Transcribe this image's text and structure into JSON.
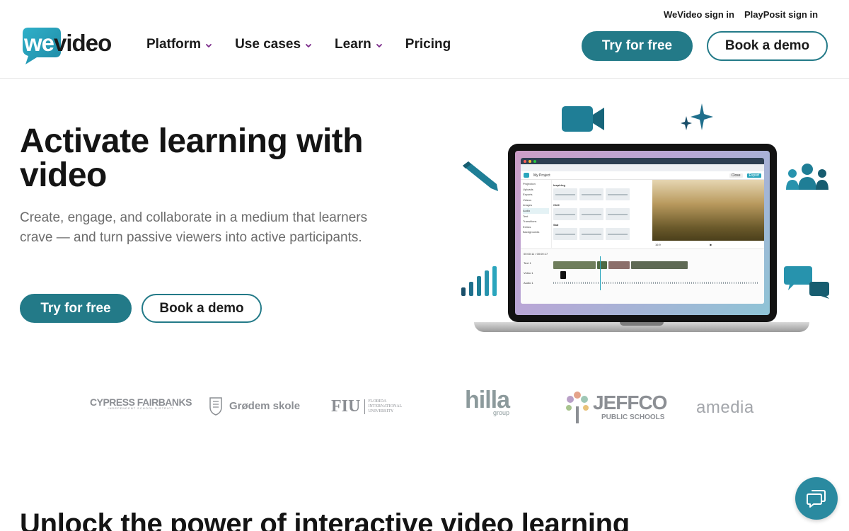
{
  "header": {
    "utility_links": [
      "WeVideo sign in",
      "PlayPosit sign in"
    ],
    "logo": {
      "we": "we",
      "video": "video"
    },
    "nav": [
      {
        "label": "Platform",
        "has_dropdown": true
      },
      {
        "label": "Use cases",
        "has_dropdown": true
      },
      {
        "label": "Learn",
        "has_dropdown": true
      },
      {
        "label": "Pricing",
        "has_dropdown": false
      }
    ],
    "cta_primary": "Try for free",
    "cta_secondary": "Book a demo"
  },
  "hero": {
    "title": "Activate learning with video",
    "subtitle": "Create, engage, and collaborate in a medium that learners crave — and turn passive viewers into active participants.",
    "cta_primary": "Try for free",
    "cta_secondary": "Book a demo"
  },
  "editor_mock": {
    "project_name": "My Project",
    "sidebar_items": [
      "Projection",
      "Uploads",
      "Exports",
      "Videos",
      "Images",
      "Audio",
      "Text",
      "Transitions",
      "Extras",
      "Backgrounds"
    ],
    "library_sections": [
      "Inspiring",
      "Chill",
      "Sad"
    ],
    "search_placeholder": "Search audio",
    "buttons": [
      "Close",
      "Export"
    ],
    "tracks": [
      "Text 1",
      "Video 1",
      "Audio 1"
    ],
    "timecode": "00:00:11 / 00:00:17",
    "aspect": "16:9"
  },
  "partners": [
    {
      "name": "CYPRESS FAIRBANKS",
      "sub": "INDEPENDENT SCHOOL DISTRICT"
    },
    {
      "name": "Grødem skole",
      "sub": ""
    },
    {
      "name": "FIU",
      "sub": "FLORIDA INTERNATIONAL UNIVERSITY"
    },
    {
      "name": "hilla",
      "sub": "group"
    },
    {
      "name": "JEFFCO",
      "sub": "PUBLIC SCHOOLS"
    },
    {
      "name": "amedia",
      "sub": ""
    }
  ],
  "section": {
    "title": "Unlock the power of interactive video learning"
  },
  "colors": {
    "brand_teal": "#237a88",
    "brand_teal_light": "#2aa5bd",
    "text_dark": "#1b1b1b",
    "text_muted": "#6c6c6c",
    "logo_gray": "#8c8f94"
  },
  "icons": [
    "chevron-down-icon",
    "video-camera-icon",
    "sparkle-icon",
    "pencil-icon",
    "people-icon",
    "bar-chart-icon",
    "chat-bubbles-icon",
    "chat-icon"
  ]
}
